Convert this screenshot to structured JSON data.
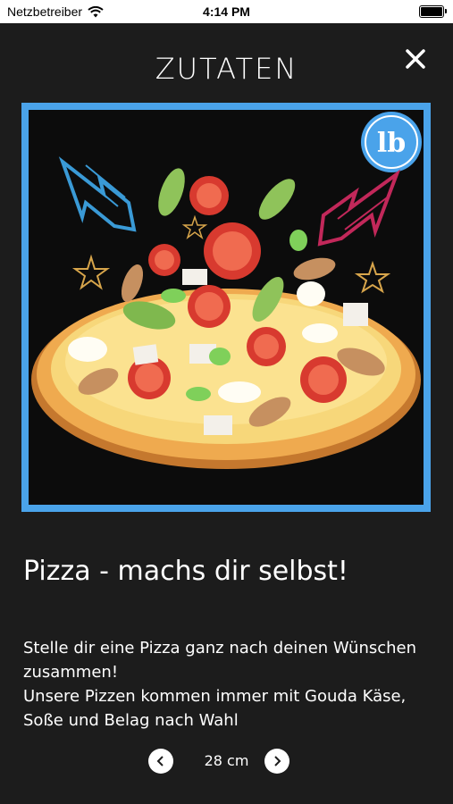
{
  "status": {
    "carrier": "Netzbetreiber",
    "time": "4:14 PM"
  },
  "header": {
    "title": "ZUTATEN",
    "close_icon": "close-icon"
  },
  "product": {
    "badge": "lb",
    "heading": "Pizza - machs dir selbst!",
    "description_lines": [
      "Stelle dir eine Pizza ganz nach deinen Wünschen zusammen!",
      "Unsere Pizzen kommen immer mit Gouda Käse, Soße und Belag nach Wahl"
    ]
  },
  "size_selector": {
    "value": "28 cm",
    "prev_icon": "chevron-left-icon",
    "next_icon": "chevron-right-icon"
  },
  "colors": {
    "background": "#1c1c1c",
    "frame": "#4aa3ea"
  }
}
